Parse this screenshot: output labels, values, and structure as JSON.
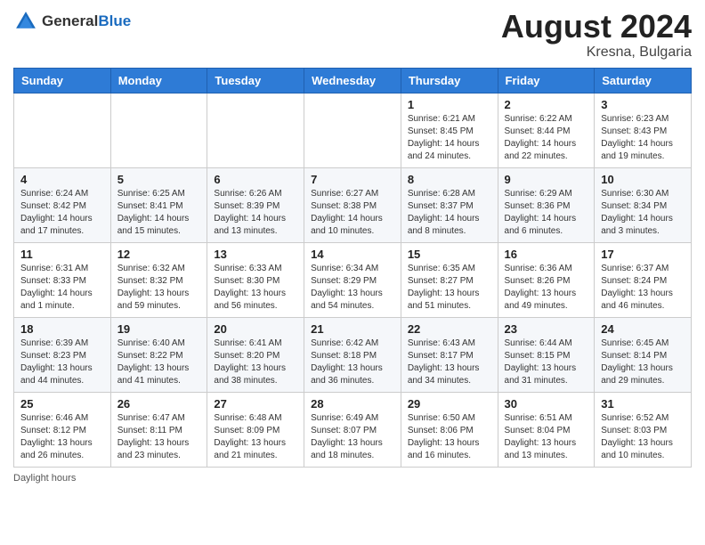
{
  "header": {
    "logo_general": "General",
    "logo_blue": "Blue",
    "month_year": "August 2024",
    "location": "Kresna, Bulgaria"
  },
  "days_of_week": [
    "Sunday",
    "Monday",
    "Tuesday",
    "Wednesday",
    "Thursday",
    "Friday",
    "Saturday"
  ],
  "weeks": [
    [
      {
        "day": "",
        "content": ""
      },
      {
        "day": "",
        "content": ""
      },
      {
        "day": "",
        "content": ""
      },
      {
        "day": "",
        "content": ""
      },
      {
        "day": "1",
        "content": "Sunrise: 6:21 AM\nSunset: 8:45 PM\nDaylight: 14 hours\nand 24 minutes."
      },
      {
        "day": "2",
        "content": "Sunrise: 6:22 AM\nSunset: 8:44 PM\nDaylight: 14 hours\nand 22 minutes."
      },
      {
        "day": "3",
        "content": "Sunrise: 6:23 AM\nSunset: 8:43 PM\nDaylight: 14 hours\nand 19 minutes."
      }
    ],
    [
      {
        "day": "4",
        "content": "Sunrise: 6:24 AM\nSunset: 8:42 PM\nDaylight: 14 hours\nand 17 minutes."
      },
      {
        "day": "5",
        "content": "Sunrise: 6:25 AM\nSunset: 8:41 PM\nDaylight: 14 hours\nand 15 minutes."
      },
      {
        "day": "6",
        "content": "Sunrise: 6:26 AM\nSunset: 8:39 PM\nDaylight: 14 hours\nand 13 minutes."
      },
      {
        "day": "7",
        "content": "Sunrise: 6:27 AM\nSunset: 8:38 PM\nDaylight: 14 hours\nand 10 minutes."
      },
      {
        "day": "8",
        "content": "Sunrise: 6:28 AM\nSunset: 8:37 PM\nDaylight: 14 hours\nand 8 minutes."
      },
      {
        "day": "9",
        "content": "Sunrise: 6:29 AM\nSunset: 8:36 PM\nDaylight: 14 hours\nand 6 minutes."
      },
      {
        "day": "10",
        "content": "Sunrise: 6:30 AM\nSunset: 8:34 PM\nDaylight: 14 hours\nand 3 minutes."
      }
    ],
    [
      {
        "day": "11",
        "content": "Sunrise: 6:31 AM\nSunset: 8:33 PM\nDaylight: 14 hours\nand 1 minute."
      },
      {
        "day": "12",
        "content": "Sunrise: 6:32 AM\nSunset: 8:32 PM\nDaylight: 13 hours\nand 59 minutes."
      },
      {
        "day": "13",
        "content": "Sunrise: 6:33 AM\nSunset: 8:30 PM\nDaylight: 13 hours\nand 56 minutes."
      },
      {
        "day": "14",
        "content": "Sunrise: 6:34 AM\nSunset: 8:29 PM\nDaylight: 13 hours\nand 54 minutes."
      },
      {
        "day": "15",
        "content": "Sunrise: 6:35 AM\nSunset: 8:27 PM\nDaylight: 13 hours\nand 51 minutes."
      },
      {
        "day": "16",
        "content": "Sunrise: 6:36 AM\nSunset: 8:26 PM\nDaylight: 13 hours\nand 49 minutes."
      },
      {
        "day": "17",
        "content": "Sunrise: 6:37 AM\nSunset: 8:24 PM\nDaylight: 13 hours\nand 46 minutes."
      }
    ],
    [
      {
        "day": "18",
        "content": "Sunrise: 6:39 AM\nSunset: 8:23 PM\nDaylight: 13 hours\nand 44 minutes."
      },
      {
        "day": "19",
        "content": "Sunrise: 6:40 AM\nSunset: 8:22 PM\nDaylight: 13 hours\nand 41 minutes."
      },
      {
        "day": "20",
        "content": "Sunrise: 6:41 AM\nSunset: 8:20 PM\nDaylight: 13 hours\nand 38 minutes."
      },
      {
        "day": "21",
        "content": "Sunrise: 6:42 AM\nSunset: 8:18 PM\nDaylight: 13 hours\nand 36 minutes."
      },
      {
        "day": "22",
        "content": "Sunrise: 6:43 AM\nSunset: 8:17 PM\nDaylight: 13 hours\nand 34 minutes."
      },
      {
        "day": "23",
        "content": "Sunrise: 6:44 AM\nSunset: 8:15 PM\nDaylight: 13 hours\nand 31 minutes."
      },
      {
        "day": "24",
        "content": "Sunrise: 6:45 AM\nSunset: 8:14 PM\nDaylight: 13 hours\nand 29 minutes."
      }
    ],
    [
      {
        "day": "25",
        "content": "Sunrise: 6:46 AM\nSunset: 8:12 PM\nDaylight: 13 hours\nand 26 minutes."
      },
      {
        "day": "26",
        "content": "Sunrise: 6:47 AM\nSunset: 8:11 PM\nDaylight: 13 hours\nand 23 minutes."
      },
      {
        "day": "27",
        "content": "Sunrise: 6:48 AM\nSunset: 8:09 PM\nDaylight: 13 hours\nand 21 minutes."
      },
      {
        "day": "28",
        "content": "Sunrise: 6:49 AM\nSunset: 8:07 PM\nDaylight: 13 hours\nand 18 minutes."
      },
      {
        "day": "29",
        "content": "Sunrise: 6:50 AM\nSunset: 8:06 PM\nDaylight: 13 hours\nand 16 minutes."
      },
      {
        "day": "30",
        "content": "Sunrise: 6:51 AM\nSunset: 8:04 PM\nDaylight: 13 hours\nand 13 minutes."
      },
      {
        "day": "31",
        "content": "Sunrise: 6:52 AM\nSunset: 8:03 PM\nDaylight: 13 hours\nand 10 minutes."
      }
    ]
  ],
  "footer": {
    "daylight_label": "Daylight hours"
  }
}
